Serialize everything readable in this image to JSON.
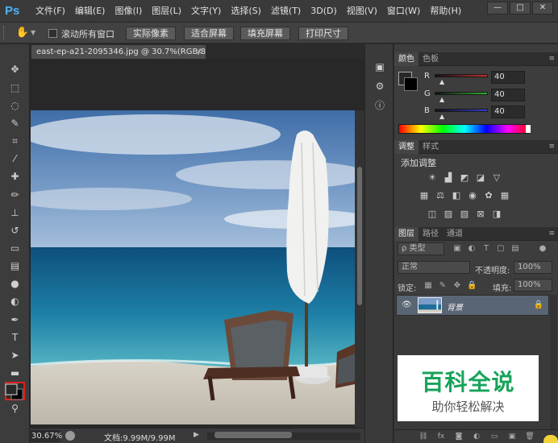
{
  "app": {
    "logo": "Ps"
  },
  "menu": [
    "文件(F)",
    "编辑(E)",
    "图像(I)",
    "图层(L)",
    "文字(Y)",
    "选择(S)",
    "滤镜(T)",
    "3D(D)",
    "视图(V)",
    "窗口(W)",
    "帮助(H)"
  ],
  "window_buttons": {
    "minimize": "—",
    "restore": "□",
    "close": "✕"
  },
  "options": {
    "scroll_all_label": "滚动所有窗口",
    "scroll_all_checked": false,
    "buttons": [
      "实际像素",
      "适合屏幕",
      "填充屏幕",
      "打印尺寸"
    ]
  },
  "document": {
    "tab_title": "east-ep-a21-2095346.jpg @ 30.7%(RGB/8)",
    "tab_close": "×",
    "zoom": "30.67%",
    "doc_size": "文档:9.99M/9.99M"
  },
  "tools": [
    {
      "name": "move-tool",
      "glyph": "✥"
    },
    {
      "name": "marquee-tool",
      "glyph": "⬚"
    },
    {
      "name": "lasso-tool",
      "glyph": "◌"
    },
    {
      "name": "quick-select-tool",
      "glyph": "✎"
    },
    {
      "name": "crop-tool",
      "glyph": "⌗"
    },
    {
      "name": "eyedropper-tool",
      "glyph": "⁄"
    },
    {
      "name": "healing-brush-tool",
      "glyph": "✚"
    },
    {
      "name": "brush-tool",
      "glyph": "✏"
    },
    {
      "name": "clone-stamp-tool",
      "glyph": "⊥"
    },
    {
      "name": "history-brush-tool",
      "glyph": "↺"
    },
    {
      "name": "eraser-tool",
      "glyph": "▭"
    },
    {
      "name": "gradient-tool",
      "glyph": "▤"
    },
    {
      "name": "blur-tool",
      "glyph": "●"
    },
    {
      "name": "dodge-tool",
      "glyph": "◐"
    },
    {
      "name": "pen-tool",
      "glyph": "✒"
    },
    {
      "name": "type-tool",
      "glyph": "T"
    },
    {
      "name": "path-select-tool",
      "glyph": "➤"
    },
    {
      "name": "shape-tool",
      "glyph": "▬"
    },
    {
      "name": "hand-tool",
      "glyph": "✋"
    },
    {
      "name": "zoom-tool",
      "glyph": "⚲"
    }
  ],
  "color_panel": {
    "tabs": [
      "颜色",
      "色板"
    ],
    "channels": [
      {
        "label": "R",
        "value": "40",
        "color": "#c83030"
      },
      {
        "label": "G",
        "value": "40",
        "color": "#30b030"
      },
      {
        "label": "B",
        "value": "40",
        "color": "#3040d0"
      }
    ]
  },
  "adjust_panel": {
    "tabs": [
      "调整",
      "样式"
    ],
    "title": "添加调整"
  },
  "layers_panel": {
    "tabs": [
      "图层",
      "路径",
      "通道"
    ],
    "filter_kind": "ρ 类型",
    "blend_mode": "正常",
    "opacity_label": "不透明度:",
    "opacity_value": "100%",
    "lock_label": "锁定:",
    "fill_label": "填充:",
    "fill_value": "100%",
    "layer_name": "背景"
  },
  "watermark": {
    "title": "百科全说",
    "subtitle": "助你轻松解决"
  }
}
